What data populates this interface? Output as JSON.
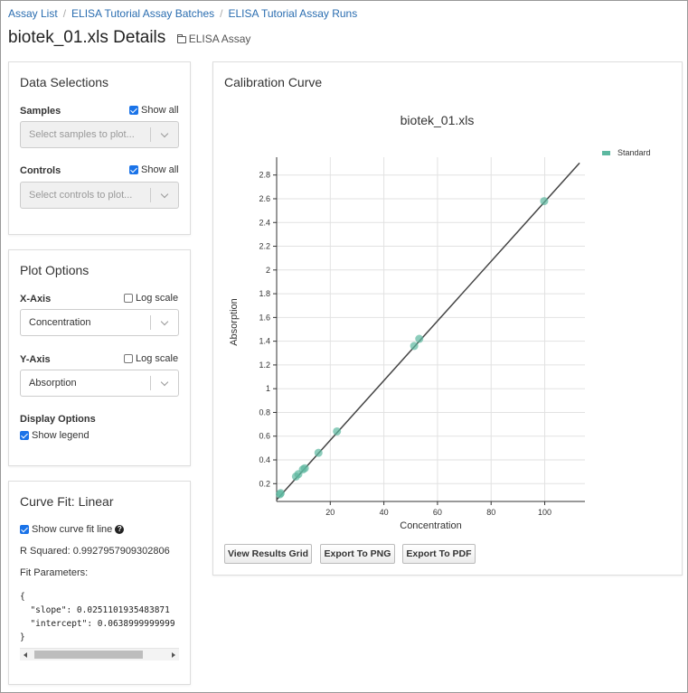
{
  "breadcrumb": [
    {
      "label": "Assay List"
    },
    {
      "label": "ELISA Tutorial Assay Batches"
    },
    {
      "label": "ELISA Tutorial Assay Runs"
    }
  ],
  "page": {
    "title": "biotek_01.xls Details",
    "assay_type": "ELISA Assay"
  },
  "data_selections": {
    "title": "Data Selections",
    "samples_label": "Samples",
    "samples_show_all": "Show all",
    "samples_placeholder": "Select samples to plot...",
    "controls_label": "Controls",
    "controls_show_all": "Show all",
    "controls_placeholder": "Select controls to plot..."
  },
  "plot_options": {
    "title": "Plot Options",
    "x_axis_label": "X-Axis",
    "x_log_scale": "Log scale",
    "x_axis_value": "Concentration",
    "y_axis_label": "Y-Axis",
    "y_log_scale": "Log scale",
    "y_axis_value": "Absorption",
    "display_options_label": "Display Options",
    "show_legend": "Show legend"
  },
  "curve_fit": {
    "title": "Curve Fit: Linear",
    "show_fit_line": "Show curve fit line",
    "r_squared": "R Squared: 0.9927957909302806",
    "fit_params_label": "Fit Parameters:",
    "json_open": "{",
    "slope_line": "  \"slope\": 0.0251101935483871",
    "intercept_line": "  \"intercept\": 0.0638999999999",
    "json_close": "}"
  },
  "calibration": {
    "panel_title": "Calibration Curve",
    "buttons": {
      "results_grid": "View Results Grid",
      "export_png": "Export To PNG",
      "export_pdf": "Export To PDF"
    }
  },
  "colors": {
    "point": "#5cb8a0",
    "fit_line": "#444444",
    "link": "#2a6db0"
  },
  "chart_data": {
    "type": "scatter",
    "title": "biotek_01.xls",
    "xlabel": "Concentration",
    "ylabel": "Absorption",
    "xlim": [
      0,
      115
    ],
    "ylim": [
      0.05,
      2.95
    ],
    "x_ticks": [
      20,
      40,
      60,
      80,
      100
    ],
    "y_ticks": [
      0.2,
      0.4,
      0.6,
      0.8,
      1,
      1.2,
      1.4,
      1.6,
      1.8,
      2,
      2.2,
      2.4,
      2.6,
      2.8
    ],
    "grid": true,
    "legend_position": "top-right",
    "series": [
      {
        "name": "Standard",
        "x": [
          1.2,
          1.5,
          7.2,
          8.1,
          9.8,
          10.5,
          15.6,
          22.5,
          51.3,
          53.2,
          99.8
        ],
        "y": [
          0.11,
          0.12,
          0.26,
          0.28,
          0.32,
          0.33,
          0.46,
          0.64,
          1.36,
          1.42,
          2.58
        ]
      }
    ],
    "fit": {
      "slope": 0.0251101935483871,
      "intercept": 0.0638999999999
    }
  }
}
